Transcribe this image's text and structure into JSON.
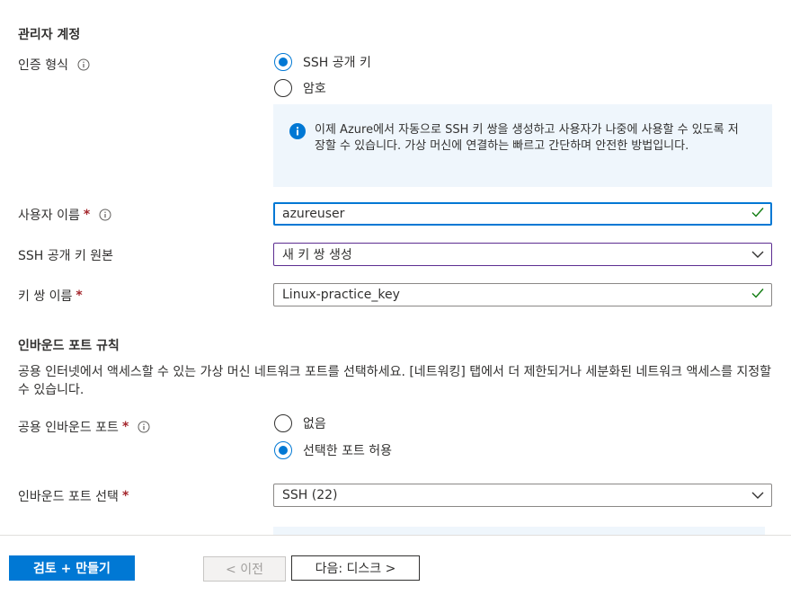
{
  "admin_section": {
    "title": "관리자 계정",
    "auth_type_label": "인증 형식",
    "auth_options": [
      "SSH 공개 키",
      "암호"
    ],
    "auth_selected": "SSH 공개 키",
    "info_text": "이제 Azure에서 자동으로 SSH 키 쌍을 생성하고 사용자가 나중에 사용할 수 있도록 저장할 수 있습니다. 가상 머신에 연결하는 빠르고 간단하며 안전한 방법입니다.",
    "username_label": "사용자 이름",
    "username_value": "azureuser",
    "ssh_source_label": "SSH 공개 키 원본",
    "ssh_source_value": "새 키 쌍 생성",
    "keypair_label": "키 쌍 이름",
    "keypair_value": "Linux-practice_key"
  },
  "inbound_section": {
    "title": "인바운드 포트 규칙",
    "description": "공용 인터넷에서 액세스할 수 있는 가상 머신 네트워크 포트를 선택하세요. [네트워킹] 탭에서 더 제한되거나 세분화된 네트워크 액세스를 지정할 수 있습니다.",
    "public_ports_label": "공용 인바운드 포트",
    "port_options": [
      "없음",
      "선택한 포트 허용"
    ],
    "port_selected": "선택한 포트 허용",
    "select_ports_label": "인바운드 포트 선택",
    "select_ports_value": "SSH (22)"
  },
  "required_marker": "*",
  "footer": {
    "review_create": "검토 + 만들기",
    "previous": "< 이전",
    "next": "다음: 디스크 >"
  },
  "colors": {
    "accent": "#0078d4",
    "valid_check": "#107c10",
    "required": "#a4262c",
    "info_bg": "#eff6fc"
  }
}
